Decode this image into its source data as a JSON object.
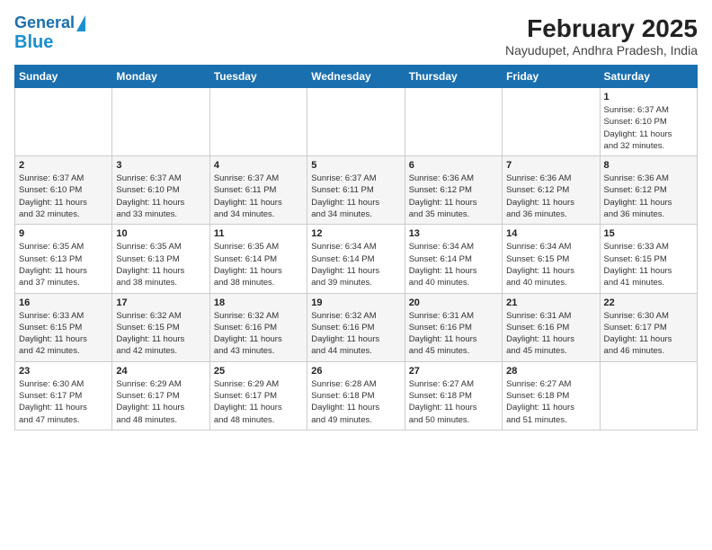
{
  "header": {
    "logo_line1": "General",
    "logo_line2": "Blue",
    "title": "February 2025",
    "subtitle": "Nayudupet, Andhra Pradesh, India"
  },
  "weekdays": [
    "Sunday",
    "Monday",
    "Tuesday",
    "Wednesday",
    "Thursday",
    "Friday",
    "Saturday"
  ],
  "weeks": [
    [
      {
        "day": "",
        "info": ""
      },
      {
        "day": "",
        "info": ""
      },
      {
        "day": "",
        "info": ""
      },
      {
        "day": "",
        "info": ""
      },
      {
        "day": "",
        "info": ""
      },
      {
        "day": "",
        "info": ""
      },
      {
        "day": "1",
        "info": "Sunrise: 6:37 AM\nSunset: 6:10 PM\nDaylight: 11 hours\nand 32 minutes."
      }
    ],
    [
      {
        "day": "2",
        "info": "Sunrise: 6:37 AM\nSunset: 6:10 PM\nDaylight: 11 hours\nand 32 minutes."
      },
      {
        "day": "3",
        "info": "Sunrise: 6:37 AM\nSunset: 6:10 PM\nDaylight: 11 hours\nand 33 minutes."
      },
      {
        "day": "4",
        "info": "Sunrise: 6:37 AM\nSunset: 6:11 PM\nDaylight: 11 hours\nand 34 minutes."
      },
      {
        "day": "5",
        "info": "Sunrise: 6:37 AM\nSunset: 6:11 PM\nDaylight: 11 hours\nand 34 minutes."
      },
      {
        "day": "6",
        "info": "Sunrise: 6:36 AM\nSunset: 6:12 PM\nDaylight: 11 hours\nand 35 minutes."
      },
      {
        "day": "7",
        "info": "Sunrise: 6:36 AM\nSunset: 6:12 PM\nDaylight: 11 hours\nand 36 minutes."
      },
      {
        "day": "8",
        "info": "Sunrise: 6:36 AM\nSunset: 6:12 PM\nDaylight: 11 hours\nand 36 minutes."
      }
    ],
    [
      {
        "day": "9",
        "info": "Sunrise: 6:35 AM\nSunset: 6:13 PM\nDaylight: 11 hours\nand 37 minutes."
      },
      {
        "day": "10",
        "info": "Sunrise: 6:35 AM\nSunset: 6:13 PM\nDaylight: 11 hours\nand 38 minutes."
      },
      {
        "day": "11",
        "info": "Sunrise: 6:35 AM\nSunset: 6:14 PM\nDaylight: 11 hours\nand 38 minutes."
      },
      {
        "day": "12",
        "info": "Sunrise: 6:34 AM\nSunset: 6:14 PM\nDaylight: 11 hours\nand 39 minutes."
      },
      {
        "day": "13",
        "info": "Sunrise: 6:34 AM\nSunset: 6:14 PM\nDaylight: 11 hours\nand 40 minutes."
      },
      {
        "day": "14",
        "info": "Sunrise: 6:34 AM\nSunset: 6:15 PM\nDaylight: 11 hours\nand 40 minutes."
      },
      {
        "day": "15",
        "info": "Sunrise: 6:33 AM\nSunset: 6:15 PM\nDaylight: 11 hours\nand 41 minutes."
      }
    ],
    [
      {
        "day": "16",
        "info": "Sunrise: 6:33 AM\nSunset: 6:15 PM\nDaylight: 11 hours\nand 42 minutes."
      },
      {
        "day": "17",
        "info": "Sunrise: 6:32 AM\nSunset: 6:15 PM\nDaylight: 11 hours\nand 42 minutes."
      },
      {
        "day": "18",
        "info": "Sunrise: 6:32 AM\nSunset: 6:16 PM\nDaylight: 11 hours\nand 43 minutes."
      },
      {
        "day": "19",
        "info": "Sunrise: 6:32 AM\nSunset: 6:16 PM\nDaylight: 11 hours\nand 44 minutes."
      },
      {
        "day": "20",
        "info": "Sunrise: 6:31 AM\nSunset: 6:16 PM\nDaylight: 11 hours\nand 45 minutes."
      },
      {
        "day": "21",
        "info": "Sunrise: 6:31 AM\nSunset: 6:16 PM\nDaylight: 11 hours\nand 45 minutes."
      },
      {
        "day": "22",
        "info": "Sunrise: 6:30 AM\nSunset: 6:17 PM\nDaylight: 11 hours\nand 46 minutes."
      }
    ],
    [
      {
        "day": "23",
        "info": "Sunrise: 6:30 AM\nSunset: 6:17 PM\nDaylight: 11 hours\nand 47 minutes."
      },
      {
        "day": "24",
        "info": "Sunrise: 6:29 AM\nSunset: 6:17 PM\nDaylight: 11 hours\nand 48 minutes."
      },
      {
        "day": "25",
        "info": "Sunrise: 6:29 AM\nSunset: 6:17 PM\nDaylight: 11 hours\nand 48 minutes."
      },
      {
        "day": "26",
        "info": "Sunrise: 6:28 AM\nSunset: 6:18 PM\nDaylight: 11 hours\nand 49 minutes."
      },
      {
        "day": "27",
        "info": "Sunrise: 6:27 AM\nSunset: 6:18 PM\nDaylight: 11 hours\nand 50 minutes."
      },
      {
        "day": "28",
        "info": "Sunrise: 6:27 AM\nSunset: 6:18 PM\nDaylight: 11 hours\nand 51 minutes."
      },
      {
        "day": "",
        "info": ""
      }
    ]
  ]
}
